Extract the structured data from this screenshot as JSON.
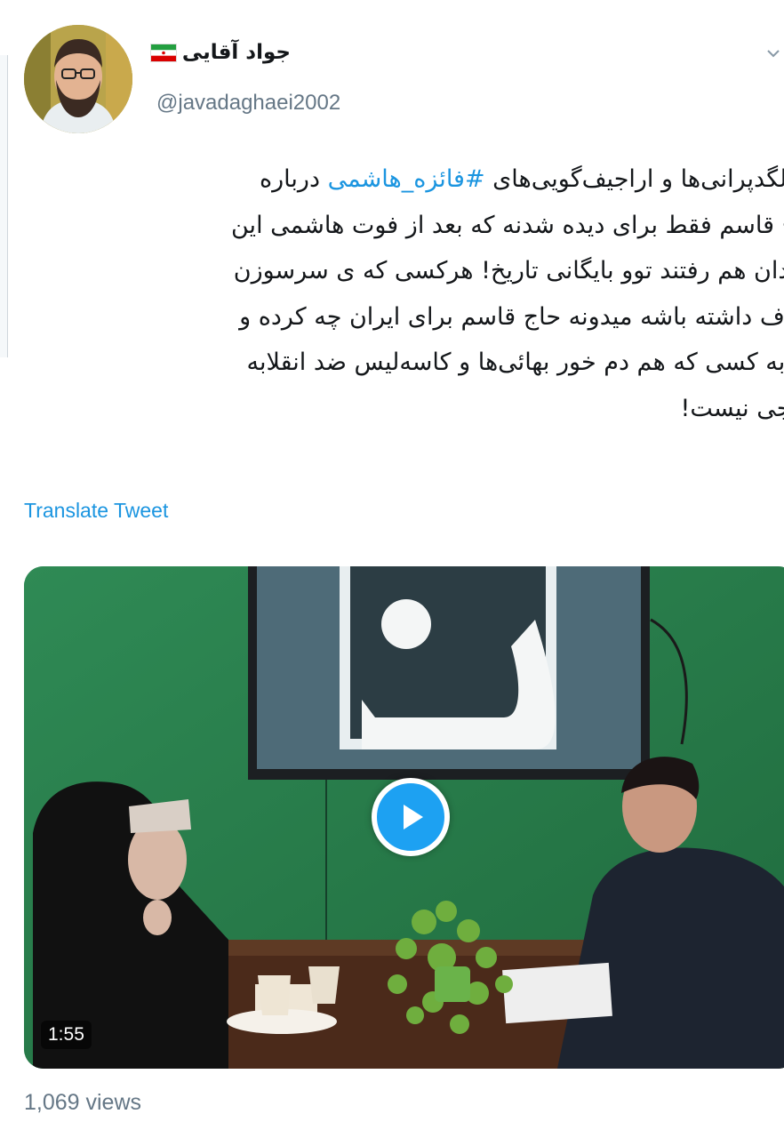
{
  "author": {
    "display_name": "جواد آقایی",
    "handle": "@javadaghaei2002",
    "flag_icon": "iran-flag-icon",
    "avatar_icon": "profile-avatar"
  },
  "tweet": {
    "line1_pre": "ین لگدپرانی‌ها و اراجیف‌گویی‌های ",
    "hashtag": "#فائزه_هاشمی",
    "line1_post": " درباره",
    "line2": "حاج قاسم فقط برای دیده شدنه که بعد از فوت هاشمی این",
    "line3": "خاندان هم رفتند توو بایگانی تاریخ! هرکسی که ی سرسوزن",
    "line4": "نصاف داشته باشه میدونه حاج قاسم برای ایران چه کرده و",
    "line5": "بته به کسی که هم دم خور بهائی‌ها و کاسه‌لیس ضد انقلابه",
    "line6": "حرجی نیست!"
  },
  "translate_label": "Translate Tweet",
  "video": {
    "duration": "1:55",
    "play_icon": "play-icon"
  },
  "views": "1,069 views",
  "colors": {
    "link": "#1b95e0",
    "secondary_text": "#657786",
    "play_button": "#1da1f2"
  }
}
